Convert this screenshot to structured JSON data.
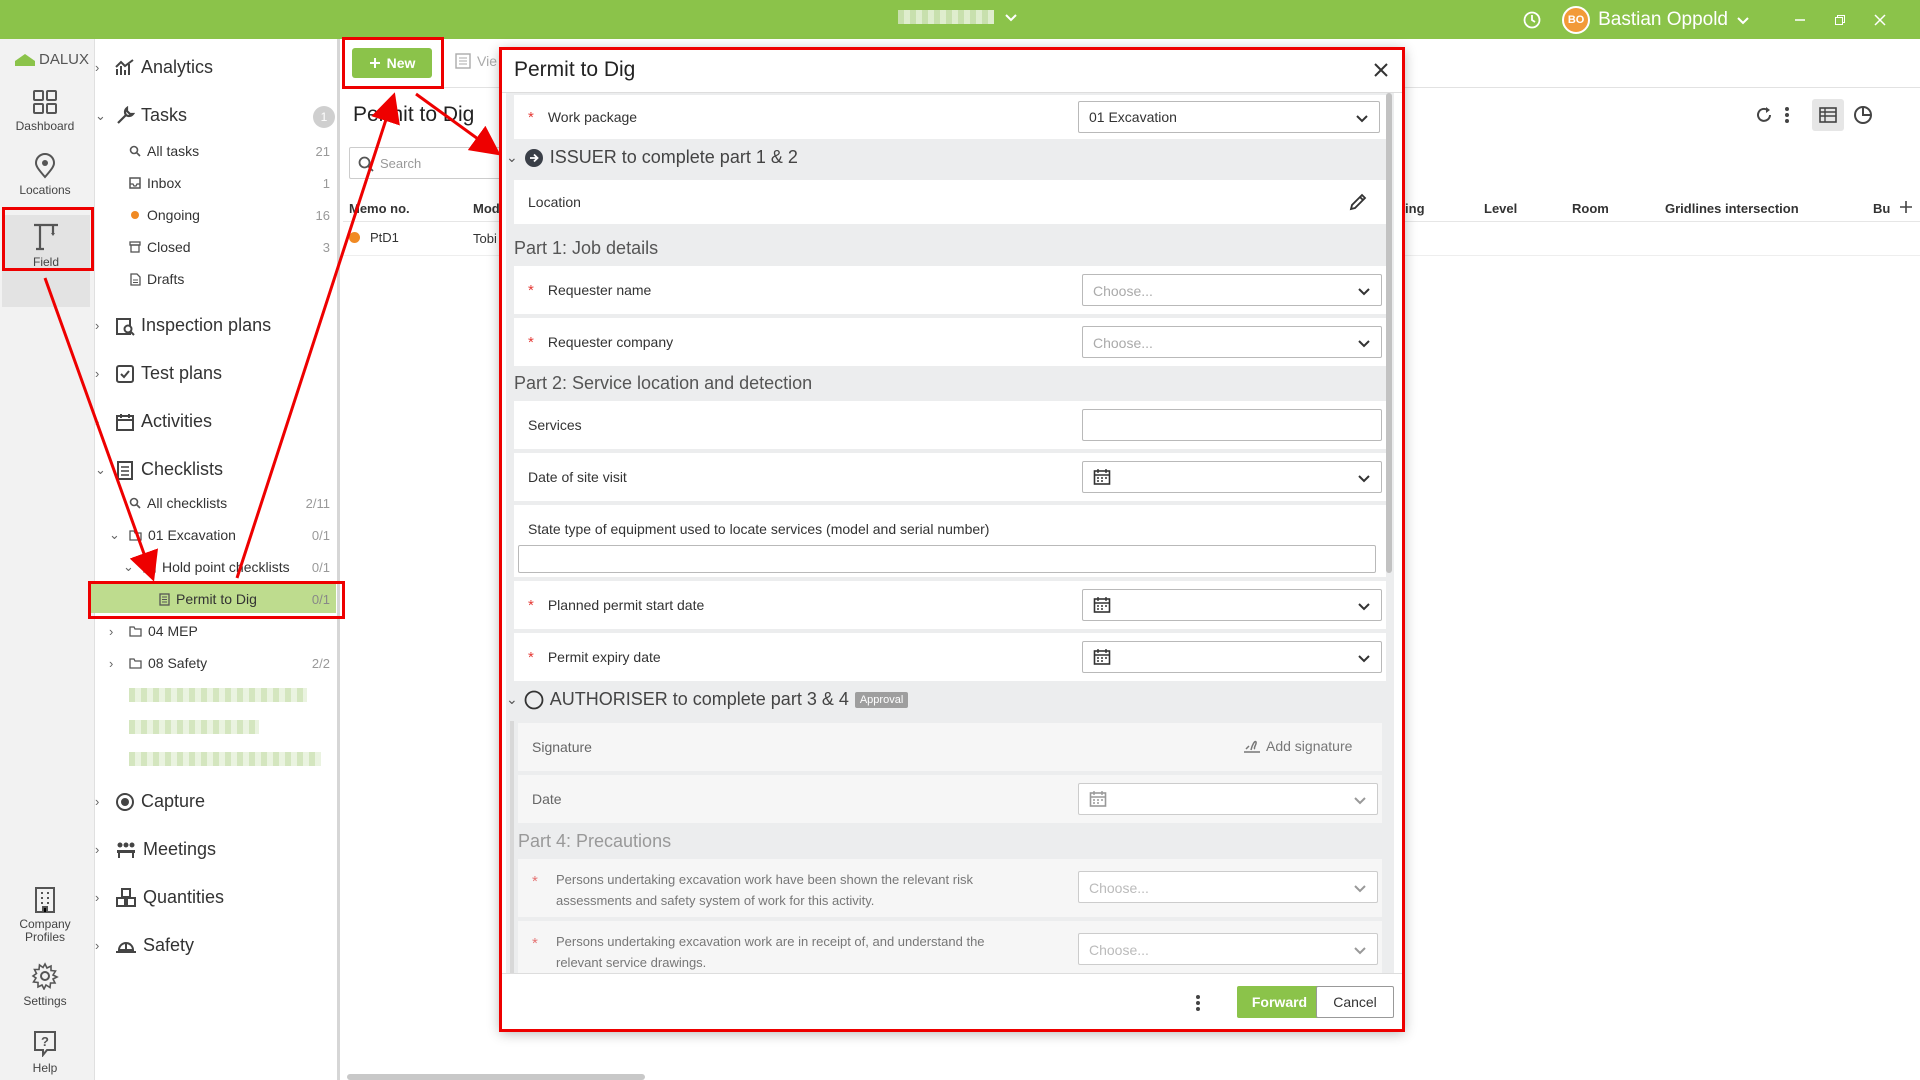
{
  "topbar": {
    "project_name": "",
    "user_initials": "BO",
    "user_name": "Bastian Oppold"
  },
  "rail": {
    "logo": "DALUX",
    "items": [
      {
        "label": "Dashboard",
        "icon": "dashboard-icon"
      },
      {
        "label": "Locations",
        "icon": "location-pin-icon"
      },
      {
        "label": "Field",
        "icon": "crane-icon"
      },
      {
        "label": "Company Profiles",
        "icon": "building-icon"
      },
      {
        "label": "Settings",
        "icon": "gear-icon"
      },
      {
        "label": "Help",
        "icon": "help-icon"
      }
    ]
  },
  "nav": {
    "analytics": "Analytics",
    "tasks": "Tasks",
    "tasks_badge": "1",
    "task_items": [
      {
        "label": "All tasks",
        "count": "21"
      },
      {
        "label": "Inbox",
        "count": "1"
      },
      {
        "label": "Ongoing",
        "count": "16"
      },
      {
        "label": "Closed",
        "count": "3"
      },
      {
        "label": "Drafts",
        "count": ""
      }
    ],
    "inspection_plans": "Inspection plans",
    "test_plans": "Test plans",
    "activities": "Activities",
    "checklists": "Checklists",
    "checklist_items": [
      {
        "label": "All checklists",
        "count": "2/11"
      },
      {
        "label": "01 Excavation",
        "count": "0/1"
      },
      {
        "label": "Hold point checklists",
        "count": "0/1"
      },
      {
        "label": "Permit to Dig",
        "count": "0/1"
      },
      {
        "label": "04 MEP",
        "count": ""
      },
      {
        "label": "08 Safety",
        "count": "2/2"
      }
    ],
    "capture": "Capture",
    "meetings": "Meetings",
    "quantities": "Quantities",
    "safety": "Safety"
  },
  "list": {
    "new_label": "New",
    "view_label": "Vie",
    "title": "Permit to Dig",
    "search_placeholder": "Search",
    "col_memo": "Memo no.",
    "col_mod": "Mod",
    "row_memo": "PtD1",
    "row_mod": "Tobi",
    "columns_right": [
      "ring",
      "Level",
      "Room",
      "Gridlines intersection",
      "Bu"
    ]
  },
  "modal": {
    "title": "Permit to Dig",
    "work_package_label": "Work package",
    "work_package_value": "01 Excavation",
    "issuer_group": "ISSUER to complete part 1 & 2",
    "location_label": "Location",
    "part1": "Part 1: Job details",
    "requester_name": "Requester name",
    "requester_company": "Requester company",
    "choose_placeholder": "Choose...",
    "part2": "Part 2: Service location and detection",
    "services": "Services",
    "date_site_visit": "Date of site visit",
    "equipment_label": "State type of equipment used to locate services (model and serial number)",
    "planned_start": "Planned permit start date",
    "permit_expiry": "Permit expiry date",
    "authoriser_group": "AUTHORISER to complete part 3 & 4",
    "approval_badge": "Approval",
    "signature_label": "Signature",
    "add_signature": "Add signature",
    "date_label": "Date",
    "part4": "Part 4: Precautions",
    "precaution1": "Persons undertaking excavation work have been shown the relevant risk assessments and safety system of work for this activity.",
    "precaution2": "Persons undertaking excavation work are in receipt of, and understand the relevant service drawings.",
    "forward": "Forward",
    "cancel": "Cancel"
  },
  "colors": {
    "accent": "#8bc34a",
    "annotation": "#e00000",
    "required": "#e53935"
  }
}
